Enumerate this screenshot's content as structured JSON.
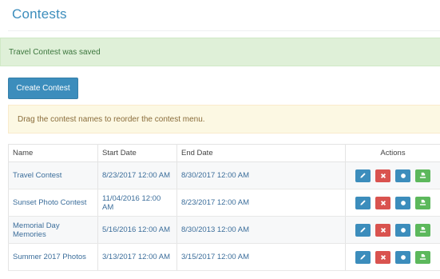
{
  "header": {
    "title": "Contests"
  },
  "alerts": {
    "success": "Travel Contest was saved",
    "info": "Drag the contest names to reorder the contest menu."
  },
  "toolbar": {
    "create_label": "Create Contest"
  },
  "table": {
    "columns": [
      "Name",
      "Start Date",
      "End Date",
      "Actions"
    ],
    "rows": [
      {
        "name": "Travel Contest",
        "start": "8/23/2017 12:00 AM",
        "end": "8/30/2017 12:00 AM"
      },
      {
        "name": "Sunset Photo Contest",
        "start": "11/04/2016 12:00 AM",
        "end": "8/23/2017 12:00 AM"
      },
      {
        "name": "Memorial Day Memories",
        "start": "5/16/2016 12:00 AM",
        "end": "8/30/2013 12:00 AM"
      },
      {
        "name": "Summer 2017 Photos",
        "start": "3/13/2017 12:00 AM",
        "end": "3/15/2017 12:00 AM"
      }
    ],
    "action_icons": [
      "pencil-icon",
      "close-icon",
      "circle-icon",
      "export-icon"
    ]
  },
  "colors": {
    "primary": "#3c8dbc",
    "danger": "#d9534f",
    "success": "#5cb85c",
    "success_bg": "#dff0d8",
    "warning_bg": "#fcf8e3"
  }
}
